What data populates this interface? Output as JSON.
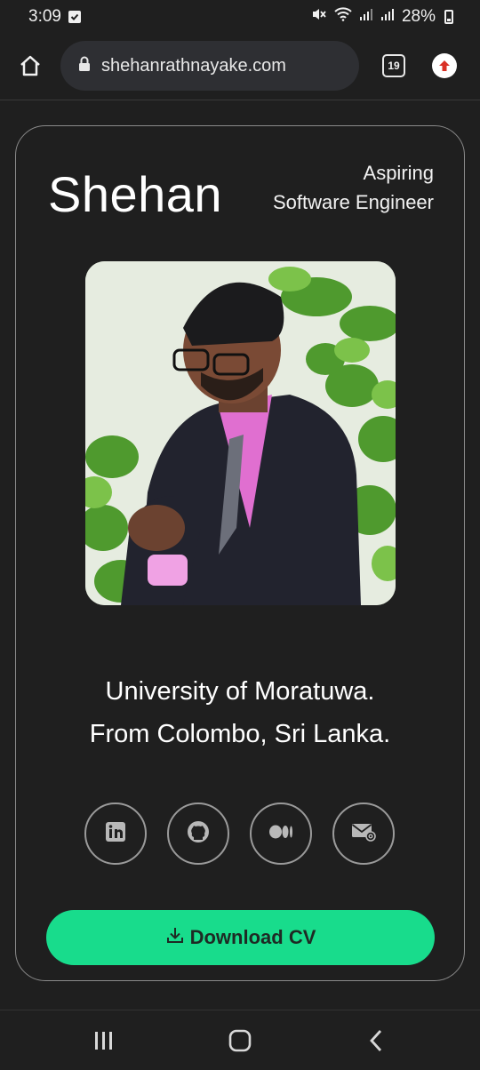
{
  "status_bar": {
    "time": "3:09",
    "battery_percent": "28%",
    "battery_level": 0.28,
    "icons": [
      "check-notification-icon",
      "mute-icon",
      "wifi-icon",
      "signal-icon",
      "signal-icon",
      "battery-icon"
    ]
  },
  "browser": {
    "url": "shehanrathnayake.com",
    "tab_count": "19",
    "icons": [
      "home-icon",
      "lock-icon",
      "tabs-icon",
      "update-arrow-icon"
    ]
  },
  "profile": {
    "name": "Shehan",
    "role_line1": "Aspiring",
    "role_line2": "Software Engineer",
    "photo_icon": "profile-photo",
    "tagline_line1": "University of Moratuwa.",
    "tagline_line2": "From Colombo, Sri Lanka.",
    "socials": [
      {
        "name": "linkedin",
        "icon": "linkedin-icon"
      },
      {
        "name": "github",
        "icon": "github-icon"
      },
      {
        "name": "medium",
        "icon": "medium-icon"
      },
      {
        "name": "email",
        "icon": "email-icon"
      }
    ],
    "download_label": "Download CV"
  },
  "colors": {
    "background": "#1f1f1f",
    "accent": "#18dc8c",
    "card_border": "#8a8a8a"
  },
  "nav_bar": {
    "icons": [
      "recent-apps-icon",
      "home-nav-icon",
      "back-icon"
    ]
  }
}
